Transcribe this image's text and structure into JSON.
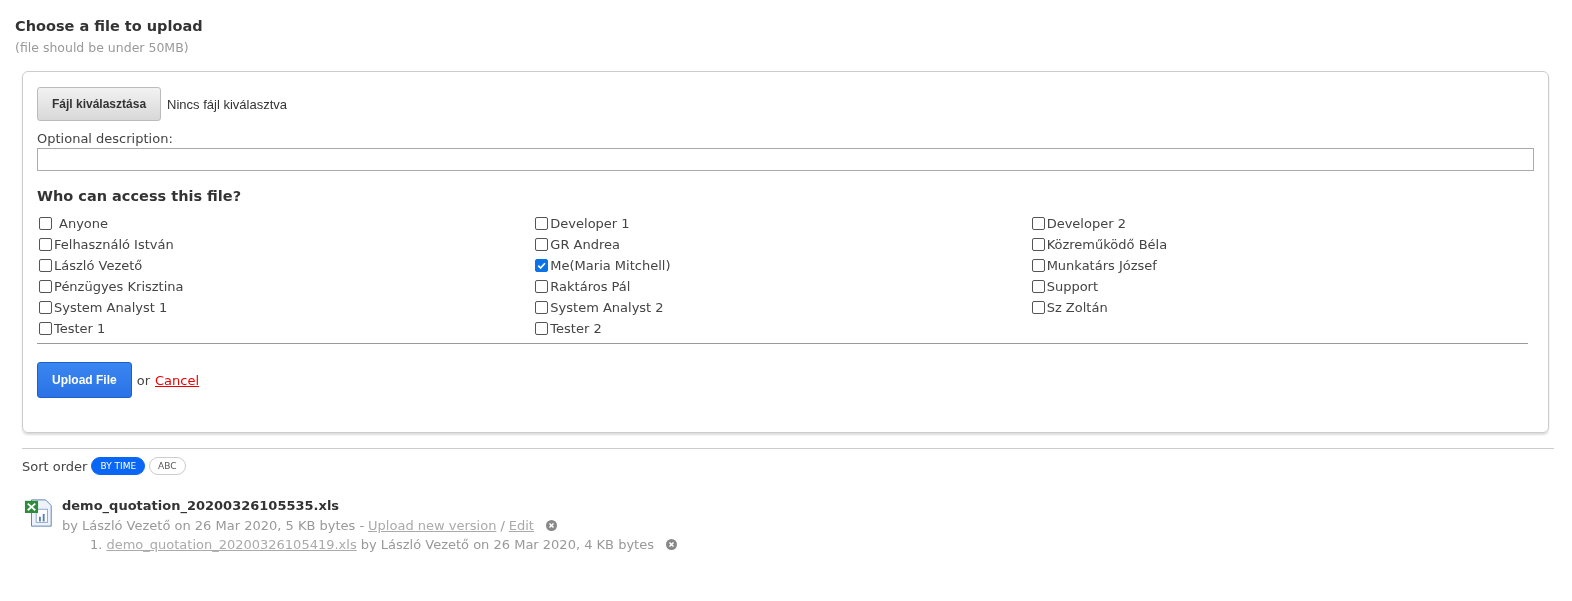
{
  "heading": "Choose a file to upload",
  "subheading": "(file should be under 50MB)",
  "file_input": {
    "button": "Fájl kiválasztása",
    "status": "Nincs fájl kiválasztva"
  },
  "description": {
    "label": "Optional description:"
  },
  "access": {
    "title": "Who can access this file?",
    "options": [
      {
        "label": "Anyone",
        "checked": false
      },
      {
        "label": "Developer 1",
        "checked": false
      },
      {
        "label": "Developer 2",
        "checked": false
      },
      {
        "label": "Felhasználó István",
        "checked": false
      },
      {
        "label": "GR Andrea",
        "checked": false
      },
      {
        "label": "Közreműködő Béla",
        "checked": false
      },
      {
        "label": "László Vezető",
        "checked": false
      },
      {
        "label": "Me(Maria Mitchell)",
        "checked": true
      },
      {
        "label": "Munkatárs József",
        "checked": false
      },
      {
        "label": "Pénzügyes Krisztina",
        "checked": false
      },
      {
        "label": "Raktáros Pál",
        "checked": false
      },
      {
        "label": "Support",
        "checked": false
      },
      {
        "label": "System Analyst 1",
        "checked": false
      },
      {
        "label": "System Analyst 2",
        "checked": false
      },
      {
        "label": "Sz Zoltán",
        "checked": false
      },
      {
        "label": "Tester 1",
        "checked": false
      },
      {
        "label": "Tester 2",
        "checked": false
      }
    ]
  },
  "actions": {
    "submit": "Upload File",
    "separator": "or",
    "cancel": "Cancel"
  },
  "sort": {
    "label": "Sort order",
    "options": [
      {
        "label": "BY TIME",
        "selected": true
      },
      {
        "label": "ABC",
        "selected": false
      }
    ]
  },
  "files": [
    {
      "name": "demo_quotation_20200326105535.xls",
      "meta": "by László Vezető on 26 Mar 2020, 5 KB bytes -",
      "upload_link": "Upload new version",
      "slash": "/",
      "edit_link": "Edit",
      "versions": [
        {
          "number": "1.",
          "name": "demo_quotation_20200326105419.xls",
          "meta": "by László Vezető on 26 Mar 2020, 4 KB bytes"
        }
      ]
    }
  ]
}
